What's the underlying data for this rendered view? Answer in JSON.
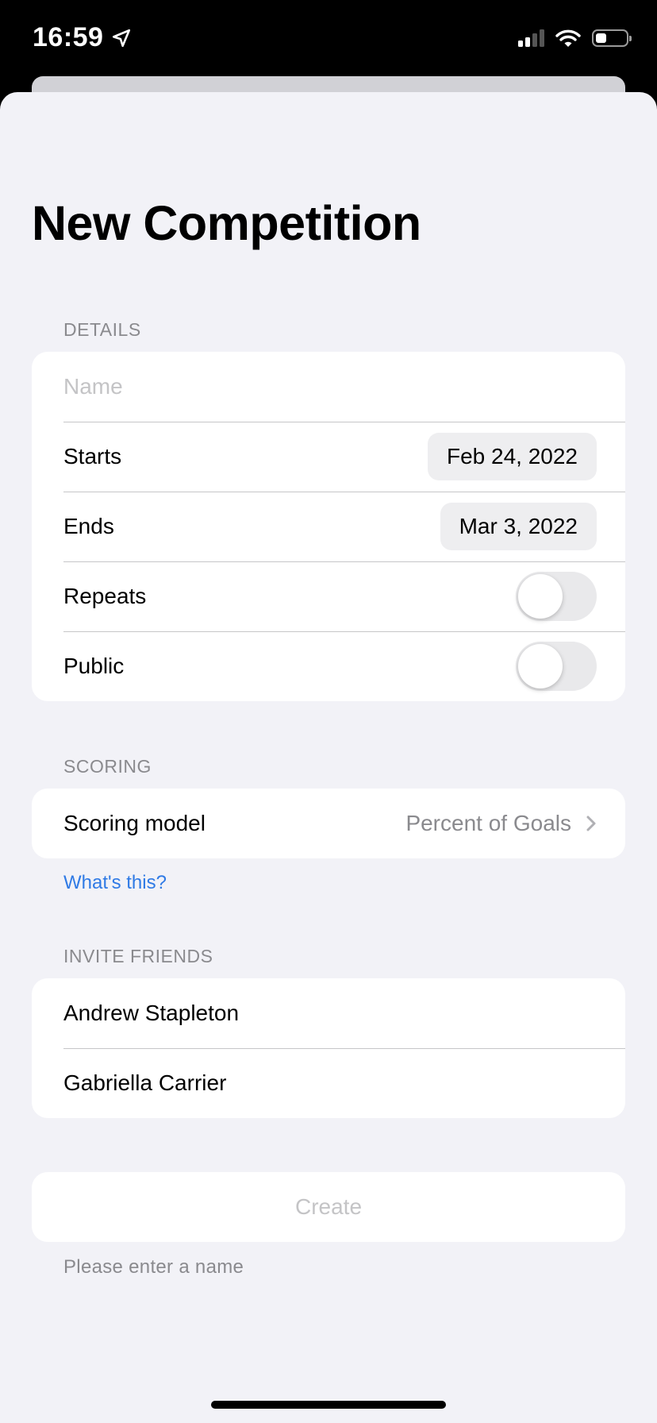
{
  "status_bar": {
    "time": "16:59",
    "location_icon": "location-arrow-icon",
    "signal_icon": "cellular-signal-icon",
    "wifi_icon": "wifi-icon",
    "battery_icon": "battery-icon",
    "battery_level": 0.35
  },
  "page": {
    "title": "New Competition"
  },
  "details": {
    "header": "DETAILS",
    "name_placeholder": "Name",
    "name_value": "",
    "starts_label": "Starts",
    "starts_value": "Feb 24, 2022",
    "ends_label": "Ends",
    "ends_value": "Mar 3, 2022",
    "repeats_label": "Repeats",
    "repeats_on": false,
    "public_label": "Public",
    "public_on": false
  },
  "scoring": {
    "header": "SCORING",
    "model_label": "Scoring model",
    "model_value": "Percent of Goals",
    "chevron_icon": "chevron-right-icon",
    "help_link": "What's this?"
  },
  "invite": {
    "header": "INVITE FRIENDS",
    "friends": [
      {
        "name": "Andrew Stapleton"
      },
      {
        "name": "Gabriella Carrier"
      }
    ]
  },
  "actions": {
    "create_label": "Create",
    "create_enabled": false,
    "validation_message": "Please enter a name"
  },
  "colors": {
    "background": "#f2f2f7",
    "link": "#2f7ae5",
    "secondary_text": "#8a8a8e",
    "disabled_text": "#c4c4c6"
  }
}
